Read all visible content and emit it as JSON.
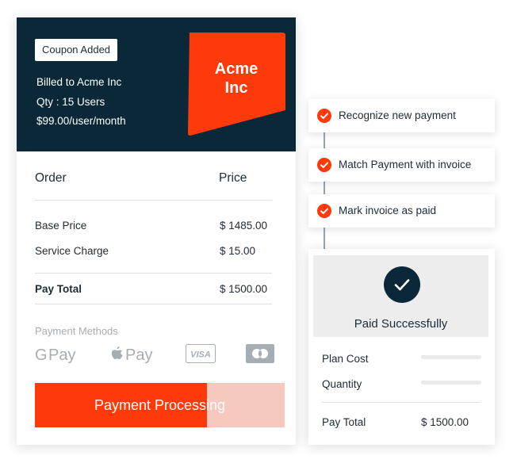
{
  "invoice": {
    "coupon_badge": "Coupon Added",
    "billed_to": "Billed to Acme Inc",
    "qty": "Qty : 15 Users",
    "rate": "$99.00/user/month",
    "logo_text_line1": "Acme",
    "logo_text_line2": "Inc",
    "logo_color": "#ff3a0a",
    "header_color": "#0b2839"
  },
  "order": {
    "col_order": "Order",
    "col_price": "Price",
    "rows": [
      {
        "label": "Base Price",
        "value": "$ 1485.00"
      },
      {
        "label": "Service Charge",
        "value": "$ 15.00"
      }
    ],
    "total_label": "Pay Total",
    "total_value": "$ 1500.00"
  },
  "payment_methods": {
    "label": "Payment Methods",
    "icons": [
      "google-pay-icon",
      "apple-pay-icon",
      "visa-icon",
      "mastercard-icon"
    ]
  },
  "progress_button": {
    "label": "Payment Processing",
    "progress_fraction": 0.69,
    "fill_color": "#ff3a0a",
    "track_color": "#f7c8bd"
  },
  "steps": [
    {
      "label": "Recognize new payment",
      "icon": "check-circle-icon"
    },
    {
      "label": "Match Payment with invoice",
      "icon": "check-circle-icon"
    },
    {
      "label": "Mark invoice as paid",
      "icon": "check-circle-icon"
    }
  ],
  "receipt": {
    "status": "Paid Successfully",
    "plan_cost_label": "Plan Cost",
    "quantity_label": "Quantity",
    "total_label": "Pay Total",
    "total_value": "$ 1500.00"
  }
}
